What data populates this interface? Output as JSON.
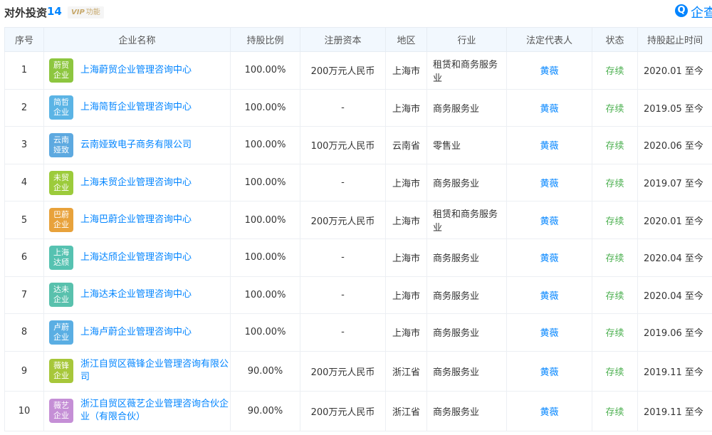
{
  "header": {
    "title": "对外投资",
    "count": "14",
    "vip_tag": "VIP",
    "vip_text": "功能",
    "brand_icon": "Q",
    "brand_text": "企查"
  },
  "table": {
    "columns": [
      "序号",
      "企业名称",
      "持股比例",
      "注册资本",
      "地区",
      "行业",
      "法定代表人",
      "状态",
      "持股起止时间"
    ],
    "rows": [
      {
        "no": "1",
        "logo": "蔚贸\n企业",
        "logo_color": "#8dc63f",
        "company": "上海蔚贸企业管理咨询中心",
        "ratio": "100.00%",
        "capital": "200万元人民币",
        "region": "上海市",
        "industry": "租赁和商务服务业",
        "rep": "黄薇",
        "status": "存续",
        "period": "2020.01 至今"
      },
      {
        "no": "2",
        "logo": "简哲\n企业",
        "logo_color": "#5bb4e5",
        "company": "上海简哲企业管理咨询中心",
        "ratio": "100.00%",
        "capital": "-",
        "region": "上海市",
        "industry": "商务服务业",
        "rep": "黄薇",
        "status": "存续",
        "period": "2019.05 至今"
      },
      {
        "no": "3",
        "logo": "云南\n娅致",
        "logo_color": "#5da9e0",
        "company": "云南娅致电子商务有限公司",
        "ratio": "100.00%",
        "capital": "100万元人民币",
        "region": "云南省",
        "industry": "零售业",
        "rep": "黄薇",
        "status": "存续",
        "period": "2020.06 至今"
      },
      {
        "no": "4",
        "logo": "未贸\n企业",
        "logo_color": "#9ccb3b",
        "company": "上海未贸企业管理咨询中心",
        "ratio": "100.00%",
        "capital": "-",
        "region": "上海市",
        "industry": "商务服务业",
        "rep": "黄薇",
        "status": "存续",
        "period": "2019.07 至今"
      },
      {
        "no": "5",
        "logo": "巴蔚\n企业",
        "logo_color": "#e8a23b",
        "company": "上海巴蔚企业管理咨询中心",
        "ratio": "100.00%",
        "capital": "200万元人民币",
        "region": "上海市",
        "industry": "租赁和商务服务业",
        "rep": "黄薇",
        "status": "存续",
        "period": "2020.01 至今"
      },
      {
        "no": "6",
        "logo": "上海\n达颀",
        "logo_color": "#56c2b1",
        "company": "上海达颀企业管理咨询中心",
        "ratio": "100.00%",
        "capital": "-",
        "region": "上海市",
        "industry": "商务服务业",
        "rep": "黄薇",
        "status": "存续",
        "period": "2020.04 至今"
      },
      {
        "no": "7",
        "logo": "达未\n企业",
        "logo_color": "#59c1ad",
        "company": "上海达未企业管理咨询中心",
        "ratio": "100.00%",
        "capital": "-",
        "region": "上海市",
        "industry": "商务服务业",
        "rep": "黄薇",
        "status": "存续",
        "period": "2020.04 至今"
      },
      {
        "no": "8",
        "logo": "卢蔚\n企业",
        "logo_color": "#5aaee3",
        "company": "上海卢蔚企业管理咨询中心",
        "ratio": "100.00%",
        "capital": "-",
        "region": "上海市",
        "industry": "商务服务业",
        "rep": "黄薇",
        "status": "存续",
        "period": "2019.06 至今"
      },
      {
        "no": "9",
        "logo": "薇锋\n企业",
        "logo_color": "#a7c73a",
        "company": "浙江自贸区薇锋企业管理咨询有限公司",
        "ratio": "90.00%",
        "capital": "200万元人民币",
        "region": "浙江省",
        "industry": "商务服务业",
        "rep": "黄薇",
        "status": "存续",
        "period": "2019.11 至今"
      },
      {
        "no": "10",
        "logo": "薇艺\n企业",
        "logo_color": "#c58fd6",
        "company": "浙江自贸区薇艺企业管理咨询合伙企业（有限合伙）",
        "ratio": "90.00%",
        "capital": "200万元人民币",
        "region": "浙江省",
        "industry": "商务服务业",
        "rep": "黄薇",
        "status": "存续",
        "period": "2019.11 至今"
      }
    ]
  }
}
